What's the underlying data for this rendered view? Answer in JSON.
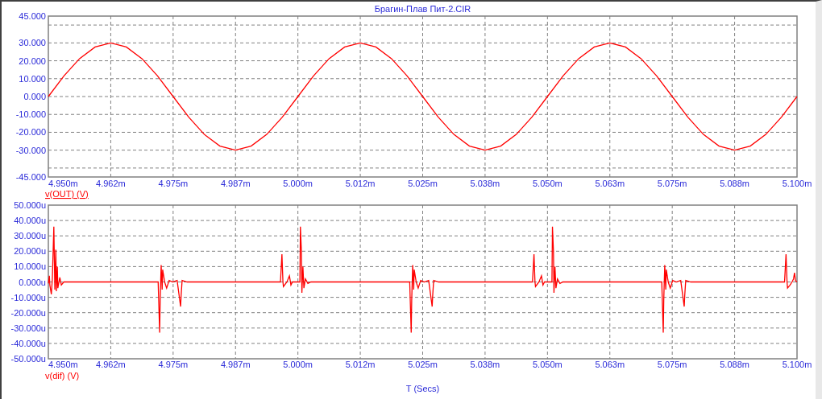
{
  "charts": [
    {
      "legend_selected": true,
      "chart_data": {
        "type": "line",
        "title": "Брагин-Плав Пит-2.CIR",
        "grid": true,
        "xlim": [
          4.95,
          5.1
        ],
        "ylim": [
          -45,
          45
        ],
        "xticks": [
          {
            "value": 4.95,
            "label": "4.950m"
          },
          {
            "value": 4.9625,
            "label": "4.962m"
          },
          {
            "value": 4.975,
            "label": "4.975m"
          },
          {
            "value": 4.9875,
            "label": "4.987m"
          },
          {
            "value": 5.0,
            "label": "5.000m"
          },
          {
            "value": 5.0125,
            "label": "5.012m"
          },
          {
            "value": 5.025,
            "label": "5.025m"
          },
          {
            "value": 5.0375,
            "label": "5.038m"
          },
          {
            "value": 5.05,
            "label": "5.050m"
          },
          {
            "value": 5.0625,
            "label": "5.063m"
          },
          {
            "value": 5.075,
            "label": "5.075m"
          },
          {
            "value": 5.0875,
            "label": "5.088m"
          },
          {
            "value": 5.1,
            "label": "5.100m"
          }
        ],
        "yticks": [
          {
            "value": 45,
            "label": "45.000"
          },
          {
            "value": 30,
            "label": "30.000"
          },
          {
            "value": 20,
            "label": "20.000"
          },
          {
            "value": 10,
            "label": "10.000"
          },
          {
            "value": 0,
            "label": "0.000"
          },
          {
            "value": -10,
            "label": "-10.000"
          },
          {
            "value": -20,
            "label": "-20.000"
          },
          {
            "value": -30,
            "label": "-30.000"
          },
          {
            "value": -45,
            "label": "-45.000"
          }
        ],
        "x": [
          4.95,
          4.953125,
          4.95625,
          4.959375,
          4.9625,
          4.965625,
          4.96875,
          4.971875,
          4.975,
          4.978125,
          4.98125,
          4.984375,
          4.9875,
          4.990625,
          4.99375,
          4.996875,
          5.0,
          5.003125,
          5.00625,
          5.009375,
          5.0125,
          5.015625,
          5.01875,
          5.021875,
          5.025,
          5.028125,
          5.03125,
          5.034375,
          5.0375,
          5.040625,
          5.04375,
          5.046875,
          5.05,
          5.053125,
          5.05625,
          5.059375,
          5.0625,
          5.065625,
          5.06875,
          5.071875,
          5.075,
          5.078125,
          5.08125,
          5.084375,
          5.0875,
          5.090625,
          5.09375,
          5.096875,
          5.1
        ],
        "series": [
          {
            "name": "v(OUT) (V)",
            "color": "#ff0000",
            "values": [
              0,
              11.5,
              21.2,
              27.7,
              30,
              27.7,
              21.2,
              11.5,
              0,
              -11.5,
              -21.2,
              -27.7,
              -30,
              -27.7,
              -21.2,
              -11.5,
              0,
              11.5,
              21.2,
              27.7,
              30,
              27.7,
              21.2,
              11.5,
              0,
              -11.5,
              -21.2,
              -27.7,
              -30,
              -27.7,
              -21.2,
              -11.5,
              0,
              11.5,
              21.2,
              27.7,
              30,
              27.7,
              21.2,
              11.5,
              0,
              -11.5,
              -21.2,
              -27.7,
              -30,
              -27.7,
              -21.2,
              -11.5,
              0
            ]
          }
        ]
      }
    },
    {
      "legend_selected": false,
      "chart_data": {
        "type": "line",
        "xlabel": "T (Secs)",
        "grid": true,
        "xlim": [
          4.95,
          5.1
        ],
        "ylim": [
          -50,
          50
        ],
        "xticks": [
          {
            "value": 4.95,
            "label": "4.950m"
          },
          {
            "value": 4.9625,
            "label": "4.962m"
          },
          {
            "value": 4.975,
            "label": "4.975m"
          },
          {
            "value": 4.9875,
            "label": "4.987m"
          },
          {
            "value": 5.0,
            "label": "5.000m"
          },
          {
            "value": 5.0125,
            "label": "5.012m"
          },
          {
            "value": 5.025,
            "label": "5.025m"
          },
          {
            "value": 5.0375,
            "label": "5.038m"
          },
          {
            "value": 5.05,
            "label": "5.050m"
          },
          {
            "value": 5.0625,
            "label": "5.063m"
          },
          {
            "value": 5.075,
            "label": "5.075m"
          },
          {
            "value": 5.0875,
            "label": "5.088m"
          },
          {
            "value": 5.1,
            "label": "5.100m"
          }
        ],
        "yticks": [
          {
            "value": 50,
            "label": "50.000u"
          },
          {
            "value": 40,
            "label": "40.000u"
          },
          {
            "value": 30,
            "label": "30.000u"
          },
          {
            "value": 20,
            "label": "20.000u"
          },
          {
            "value": 10,
            "label": "10.000u"
          },
          {
            "value": 0,
            "label": "0.000u"
          },
          {
            "value": -10,
            "label": "-10.000u"
          },
          {
            "value": -20,
            "label": "-20.000u"
          },
          {
            "value": -30,
            "label": "-30.000u"
          },
          {
            "value": -40,
            "label": "-40.000u"
          },
          {
            "value": -50,
            "label": "-50.000u"
          }
        ],
        "x": [
          4.95,
          4.9502,
          4.9503,
          4.9506,
          4.9508,
          4.9511,
          4.9513,
          4.9515,
          4.9516,
          4.9518,
          4.9519,
          4.9523,
          4.9526,
          4.9531,
          4.972,
          4.9723,
          4.9724,
          4.9726,
          4.9728,
          4.9729,
          4.9733,
          4.9737,
          4.9742,
          4.9749,
          4.9758,
          4.9765,
          4.9766,
          4.9768,
          4.9778,
          4.9965,
          4.9968,
          4.997,
          4.9971,
          4.9978,
          4.9983,
          4.9986,
          4.9989,
          5.0004,
          5.0005,
          5.0007,
          5.0008,
          5.001,
          5.0012,
          5.0015,
          5.002,
          5.0026,
          5.0224,
          5.0227,
          5.0228,
          5.023,
          5.0232,
          5.0233,
          5.0237,
          5.0241,
          5.0246,
          5.0253,
          5.0262,
          5.0269,
          5.027,
          5.0272,
          5.0282,
          5.047,
          5.0473,
          5.0475,
          5.0476,
          5.0483,
          5.0488,
          5.0491,
          5.0494,
          5.0509,
          5.051,
          5.0512,
          5.0513,
          5.0515,
          5.0517,
          5.052,
          5.0525,
          5.0531,
          5.0729,
          5.0732,
          5.0733,
          5.0735,
          5.0737,
          5.0738,
          5.0742,
          5.0746,
          5.0751,
          5.0758,
          5.0767,
          5.0774,
          5.0775,
          5.0777,
          5.0787,
          5.0975,
          5.0978,
          5.098,
          5.0981,
          5.0986,
          5.099,
          5.0993,
          5.0995,
          5.0997,
          5.1
        ],
        "series": [
          {
            "name": "v(dif) (V)",
            "color": "#ff0000",
            "values": [
              -1,
              4,
              -2,
              -8,
              2,
              36,
              -5,
              21,
              -6,
              10,
              -4,
              3,
              -2,
              0,
              0,
              -33,
              -12,
              11,
              -5,
              8,
              0,
              -4,
              1,
              0,
              1,
              -16,
              -9,
              1,
              0,
              0,
              18,
              0,
              -3,
              0,
              4,
              -2,
              0,
              0,
              36,
              20,
              -7,
              10,
              -4,
              2,
              -1,
              0,
              0,
              -33,
              -12,
              11,
              -5,
              8,
              0,
              -4,
              1,
              0,
              1,
              -16,
              -9,
              1,
              0,
              0,
              18,
              0,
              -3,
              0,
              4,
              -2,
              0,
              0,
              36,
              20,
              -7,
              10,
              -4,
              2,
              -1,
              0,
              0,
              -33,
              -12,
              11,
              -5,
              8,
              0,
              -4,
              1,
              0,
              1,
              -16,
              -9,
              1,
              0,
              0,
              18,
              0,
              -4,
              -2,
              0,
              2,
              6,
              1,
              0
            ]
          }
        ]
      }
    }
  ]
}
